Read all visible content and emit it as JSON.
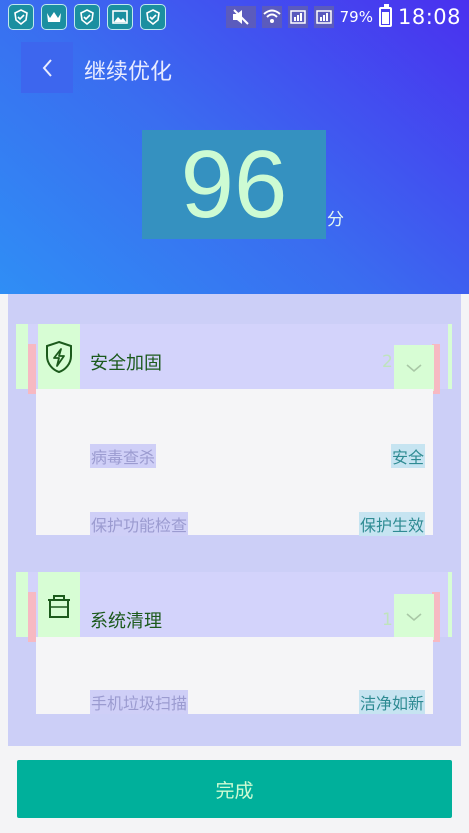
{
  "status_bar": {
    "battery": "79%",
    "time": "18:08"
  },
  "header": {
    "title": "继续优化"
  },
  "score": {
    "value": "96",
    "unit": "分"
  },
  "cards": [
    {
      "title": "安全加固",
      "count": "2",
      "icon": "lightning-shield-icon",
      "items": [
        {
          "label": "病毒查杀",
          "status": "安全"
        },
        {
          "label": "保护功能检查",
          "status": "保护生效"
        }
      ]
    },
    {
      "title": "系统清理",
      "count": "1",
      "icon": "trash-icon",
      "items": [
        {
          "label": "手机垃圾扫描",
          "status": "洁净如新"
        }
      ]
    }
  ],
  "actions": {
    "done_label": "完成"
  },
  "colors": {
    "accent": "#00b09b",
    "header_start": "#2f8ef5",
    "header_end": "#4a30ef"
  }
}
